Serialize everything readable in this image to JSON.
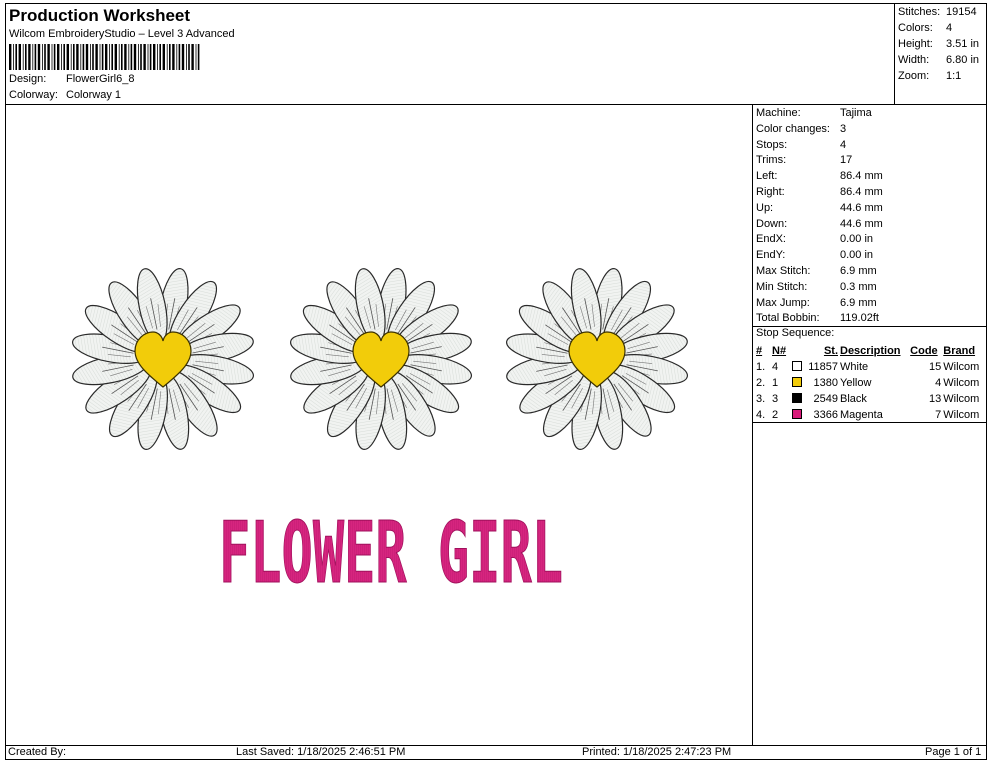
{
  "header": {
    "title": "Production Worksheet",
    "subtitle": "Wilcom EmbroideryStudio – Level 3 Advanced",
    "design_label": "Design:",
    "design_value": "FlowerGirl6_8",
    "colorway_label": "Colorway:",
    "colorway_value": "Colorway 1"
  },
  "stats": [
    {
      "label": "Stitches:",
      "value": "19154"
    },
    {
      "label": "Colors:",
      "value": "4"
    },
    {
      "label": "Height:",
      "value": "3.51 in"
    },
    {
      "label": "Width:",
      "value": "6.80 in"
    },
    {
      "label": "Zoom:",
      "value": "1:1"
    }
  ],
  "machine_info": [
    {
      "label": "Machine:",
      "value": "Tajima"
    },
    {
      "label": "Color changes:",
      "value": "3"
    },
    {
      "label": "Stops:",
      "value": "4"
    },
    {
      "label": "Trims:",
      "value": "17"
    },
    {
      "label": "Left:",
      "value": "86.4 mm"
    },
    {
      "label": "Right:",
      "value": "86.4 mm"
    },
    {
      "label": "Up:",
      "value": "44.6 mm"
    },
    {
      "label": "Down:",
      "value": "44.6 mm"
    },
    {
      "label": "EndX:",
      "value": "0.00 in"
    },
    {
      "label": "EndY:",
      "value": "0.00 in"
    },
    {
      "label": "Max Stitch:",
      "value": "6.9 mm"
    },
    {
      "label": "Min Stitch:",
      "value": "0.3 mm"
    },
    {
      "label": "Max Jump:",
      "value": "6.9 mm"
    },
    {
      "label": "Total Bobbin:",
      "value": "119.02ft"
    }
  ],
  "stop_sequence": {
    "title": "Stop Sequence:",
    "headers": {
      "hash": "#",
      "n": "N#",
      "st": "St.",
      "desc": "Description",
      "code": "Code",
      "brand": "Brand"
    },
    "rows": [
      {
        "idx": "1.",
        "n": "4",
        "color": "#ffffff",
        "st": "11857",
        "desc": "White",
        "code": "15",
        "brand": "Wilcom"
      },
      {
        "idx": "2.",
        "n": "1",
        "color": "#f2cc0a",
        "st": "1380",
        "desc": "Yellow",
        "code": "4",
        "brand": "Wilcom"
      },
      {
        "idx": "3.",
        "n": "3",
        "color": "#000000",
        "st": "2549",
        "desc": "Black",
        "code": "13",
        "brand": "Wilcom"
      },
      {
        "idx": "4.",
        "n": "2",
        "color": "#d81b7a",
        "st": "3366",
        "desc": "Magenta",
        "code": "7",
        "brand": "Wilcom"
      }
    ]
  },
  "design_text": "FLOWER GIRL",
  "footer": {
    "created_by": "Created By:",
    "last_saved": "Last Saved: 1/18/2025 2:46:51 PM",
    "printed": "Printed: 1/18/2025 2:47:23 PM",
    "page": "Page 1 of 1"
  }
}
